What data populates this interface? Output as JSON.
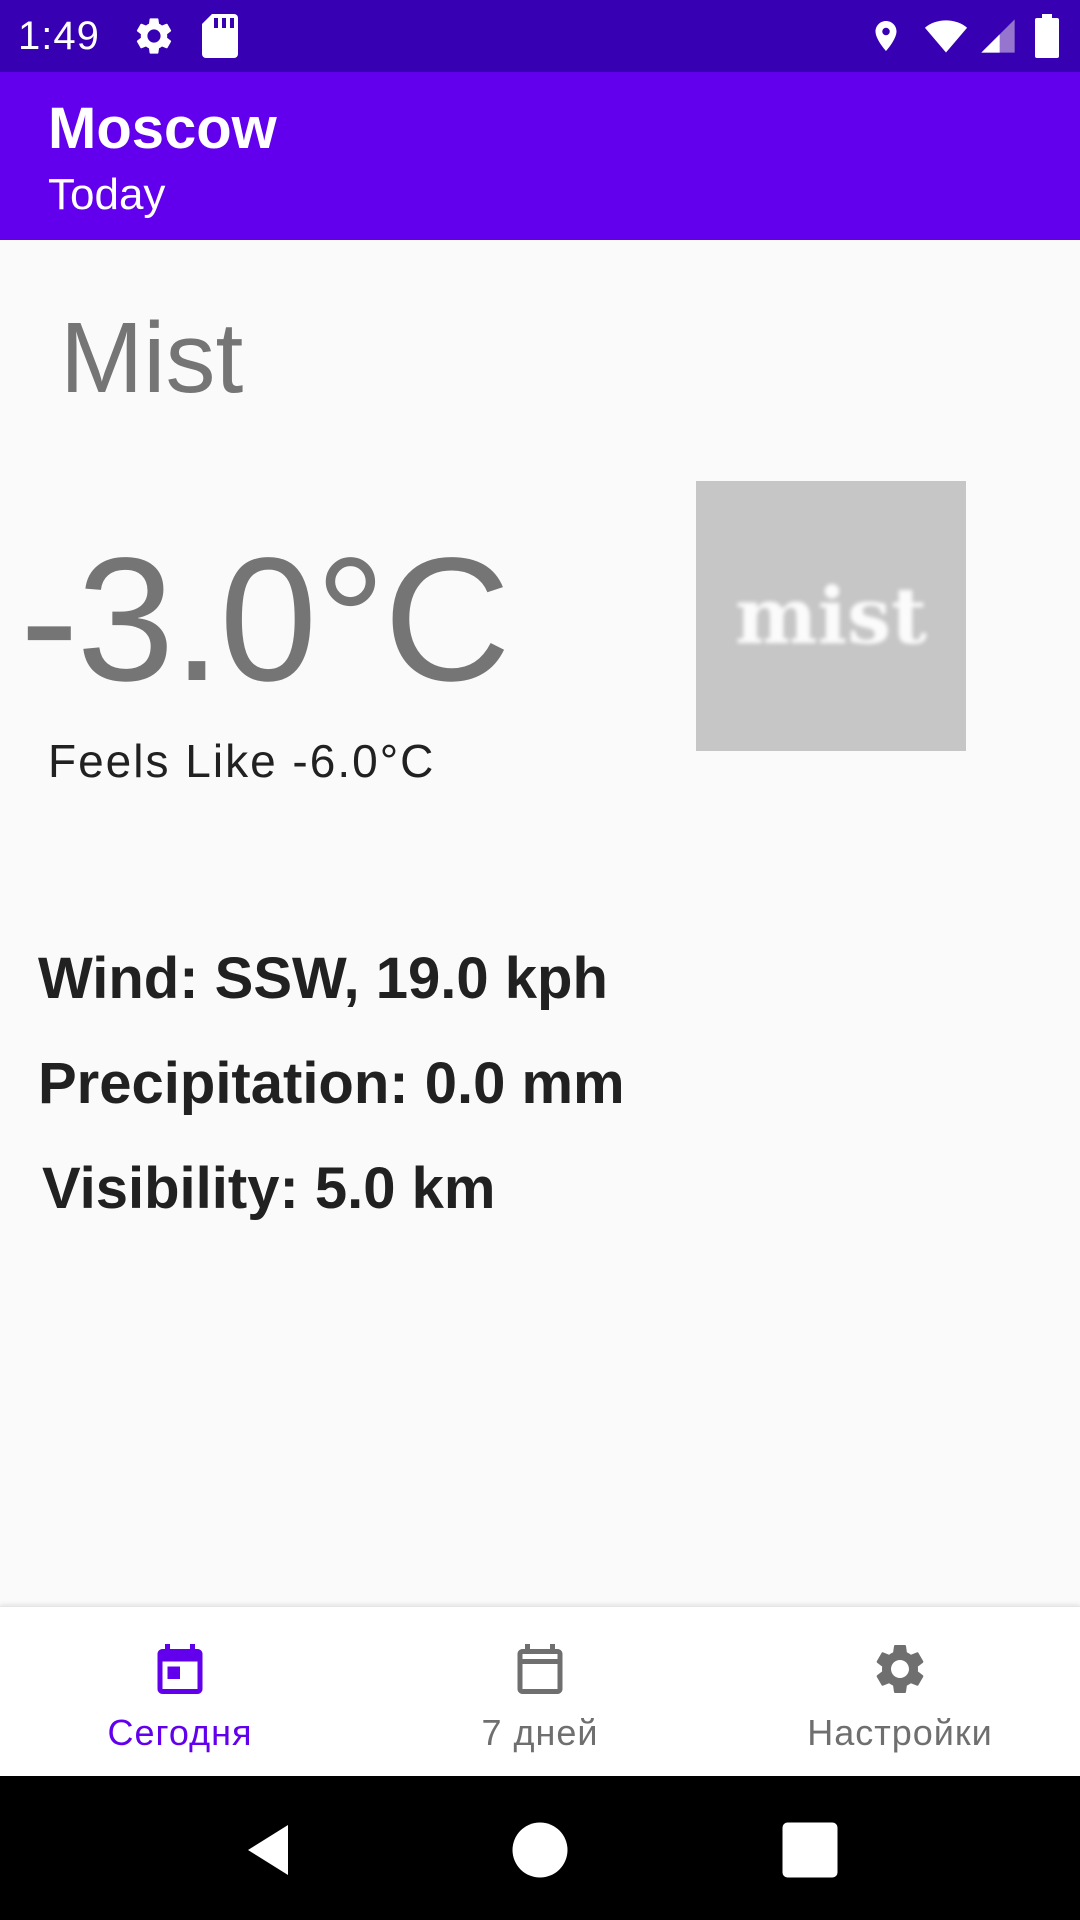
{
  "status_bar": {
    "time": "1:49",
    "icons": [
      "gear-icon",
      "sd-card-icon",
      "location-icon",
      "wifi-icon",
      "signal-icon",
      "battery-icon"
    ]
  },
  "app_bar": {
    "title": "Moscow",
    "subtitle": "Today"
  },
  "weather": {
    "condition": "Mist",
    "temperature": "-3.0°C",
    "feels_like": "Feels Like -6.0°C",
    "image_label": "mist",
    "wind": "Wind: SSW, 19.0 kph",
    "precipitation": "Precipitation: 0.0 mm",
    "visibility": "Visibility: 5.0 km"
  },
  "bottom_nav": {
    "items": [
      {
        "label": "Сегодня",
        "icon": "calendar-today-icon",
        "active": true
      },
      {
        "label": "7 дней",
        "icon": "calendar-week-icon",
        "active": false
      },
      {
        "label": "Настройки",
        "icon": "settings-icon",
        "active": false
      }
    ]
  },
  "colors": {
    "status_bar": "#3700b3",
    "app_bar": "#6200ee",
    "nav_active": "#6200ee",
    "nav_inactive": "#6f6f6f",
    "background": "#fafafa"
  }
}
